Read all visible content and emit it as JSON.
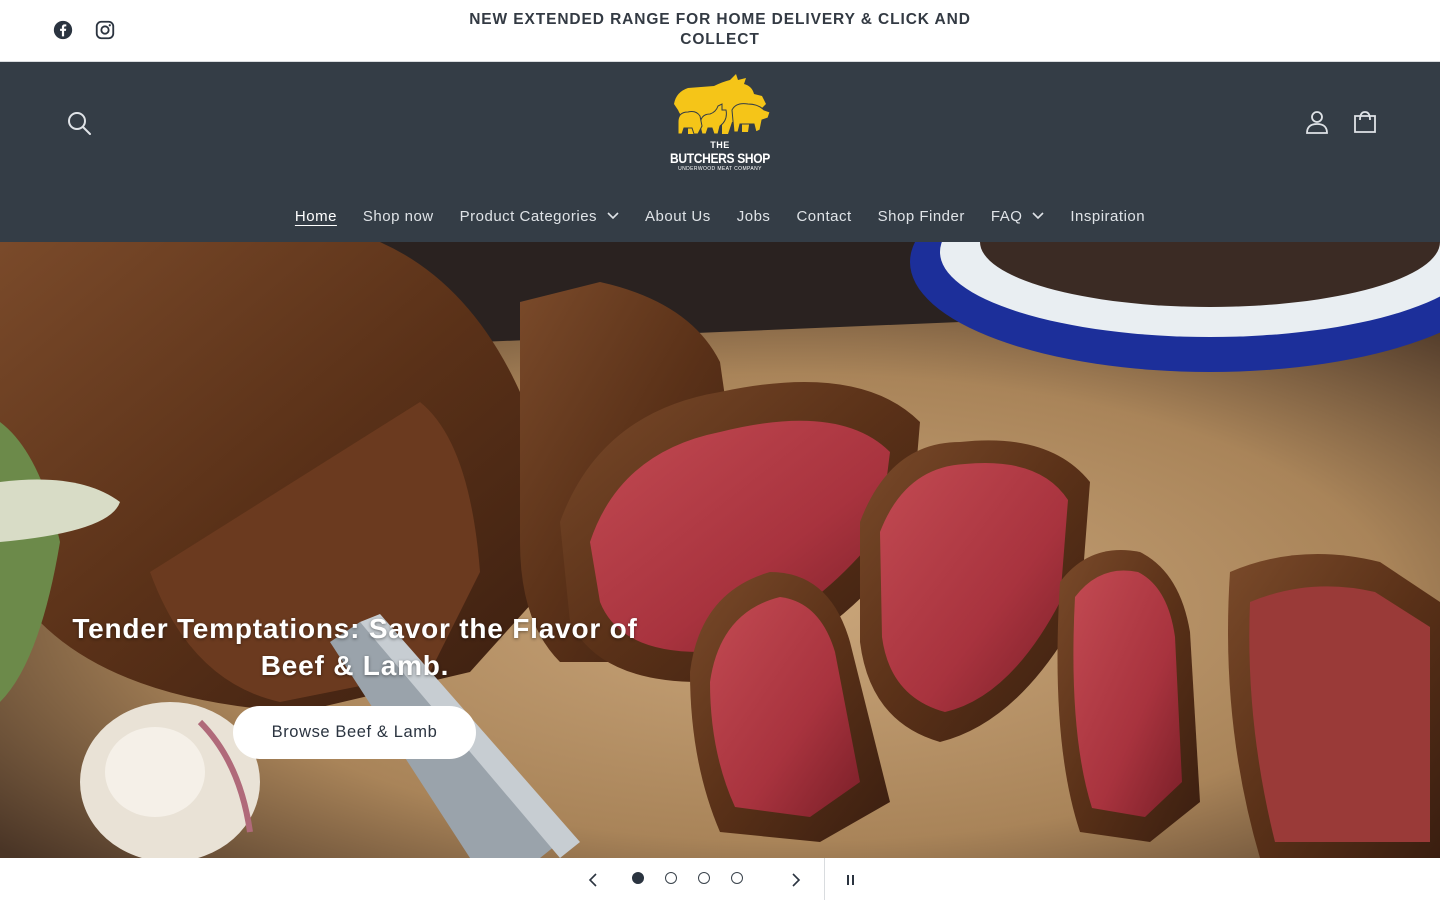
{
  "announcement": {
    "text": "NEW EXTENDED RANGE FOR HOME DELIVERY & CLICK AND COLLECT"
  },
  "social": {
    "icons": [
      "facebook-icon",
      "instagram-icon"
    ]
  },
  "header": {
    "background_color": "#343d46",
    "logo": {
      "line1": "THE",
      "line2": "BUTCHERS SHOP",
      "line3": "UNDERWOOD MEAT COMPANY",
      "color": "#f5c518"
    },
    "icons": [
      "search-icon",
      "account-icon",
      "cart-icon"
    ]
  },
  "nav": {
    "items": [
      {
        "label": "Home",
        "active": true,
        "dropdown": false
      },
      {
        "label": "Shop now",
        "active": false,
        "dropdown": false
      },
      {
        "label": "Product Categories",
        "active": false,
        "dropdown": true
      },
      {
        "label": "About Us",
        "active": false,
        "dropdown": false
      },
      {
        "label": "Jobs",
        "active": false,
        "dropdown": false
      },
      {
        "label": "Contact",
        "active": false,
        "dropdown": false
      },
      {
        "label": "Shop Finder",
        "active": false,
        "dropdown": false
      },
      {
        "label": "FAQ",
        "active": false,
        "dropdown": true
      },
      {
        "label": "Inspiration",
        "active": false,
        "dropdown": false
      }
    ]
  },
  "hero": {
    "heading": "Tender Temptations: Savor the Flavor of Beef & Lamb.",
    "cta_label": "Browse Beef & Lamb"
  },
  "slider": {
    "slide_count": 4,
    "active_slide": 1,
    "icons": [
      "chevron-left-icon",
      "chevron-right-icon",
      "pause-icon"
    ]
  }
}
